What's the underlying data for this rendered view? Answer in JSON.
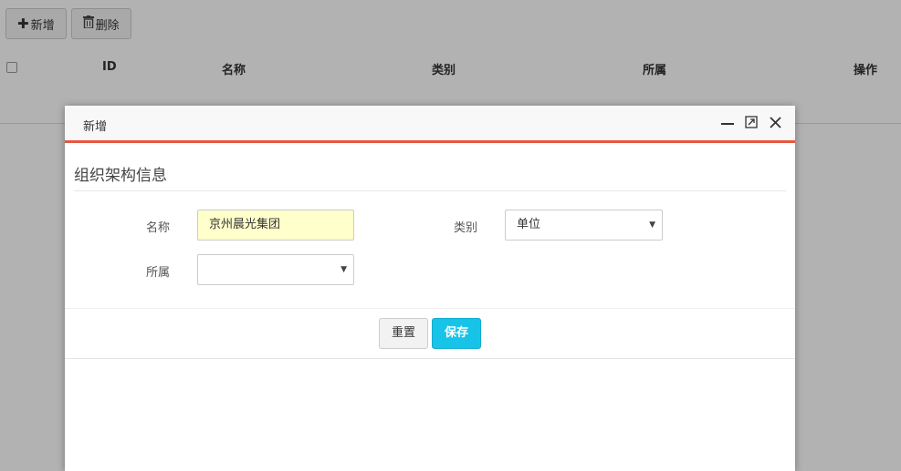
{
  "toolbar": {
    "add_icon": "plus-icon",
    "add_label": "新增",
    "delete_icon": "trash-icon",
    "delete_label": "删除"
  },
  "grid": {
    "columns": [
      "ID",
      "名称",
      "类别",
      "所属",
      "操作"
    ]
  },
  "modal": {
    "title": "新增",
    "accent_color": "#e8563f",
    "controls": [
      "minimize-icon",
      "maximize-icon",
      "close-icon"
    ],
    "section_title": "组织架构信息",
    "fields": {
      "name_label": "名称",
      "name_value": "京州晨光集团",
      "category_label": "类别",
      "category_value": "单位",
      "parent_label": "所属",
      "parent_value": ""
    },
    "buttons": {
      "reset": "重置",
      "save": "保存",
      "save_color": "#17c4e8"
    }
  }
}
